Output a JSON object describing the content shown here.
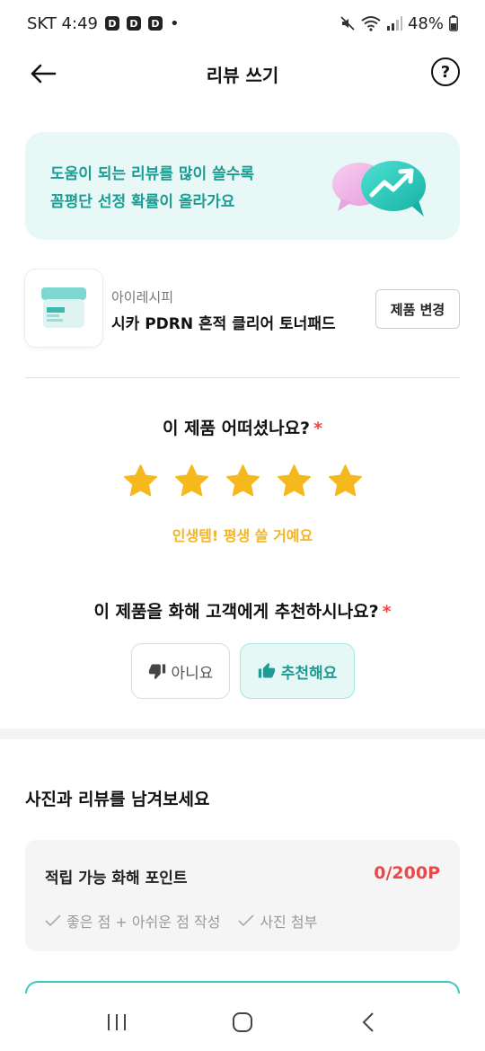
{
  "status_bar": {
    "carrier_time": "SKT 4:49",
    "badges": [
      "D",
      "D",
      "D"
    ],
    "dot": "•",
    "battery": "48%"
  },
  "header": {
    "title": "리뷰 쓰기",
    "help": "?"
  },
  "banner": {
    "line1": "도움이 되는 리뷰를 많이 쓸수록",
    "line2": "꼼평단 선정 확률이 올라가요"
  },
  "product": {
    "brand": "아이레시피",
    "name": "시카 PDRN 흔적 클리어 토너패드",
    "change_label": "제품 변경"
  },
  "rating": {
    "question": "이 제품 어떠셨나요?",
    "required_mark": "*",
    "value": 5,
    "max": 5,
    "label": "인생템! 평생 쓸 거예요"
  },
  "recommend": {
    "question": "이 제품을 화해 고객에게 추천하시나요?",
    "required_mark": "*",
    "no_label": "아니요",
    "yes_label": "추천해요",
    "selected": "yes"
  },
  "review": {
    "section_title": "사진과 리뷰를 남겨보세요",
    "points_label": "적립 가능 화해 포인트",
    "points_value": "0/200P",
    "requirements": [
      "좋은 점 + 아쉬운 점 작성",
      "사진 첨부"
    ]
  },
  "colors": {
    "accent": "#1d9c94",
    "star": "#f5b91e",
    "required": "#e84a4a",
    "banner_bg": "#e8f8f6"
  }
}
